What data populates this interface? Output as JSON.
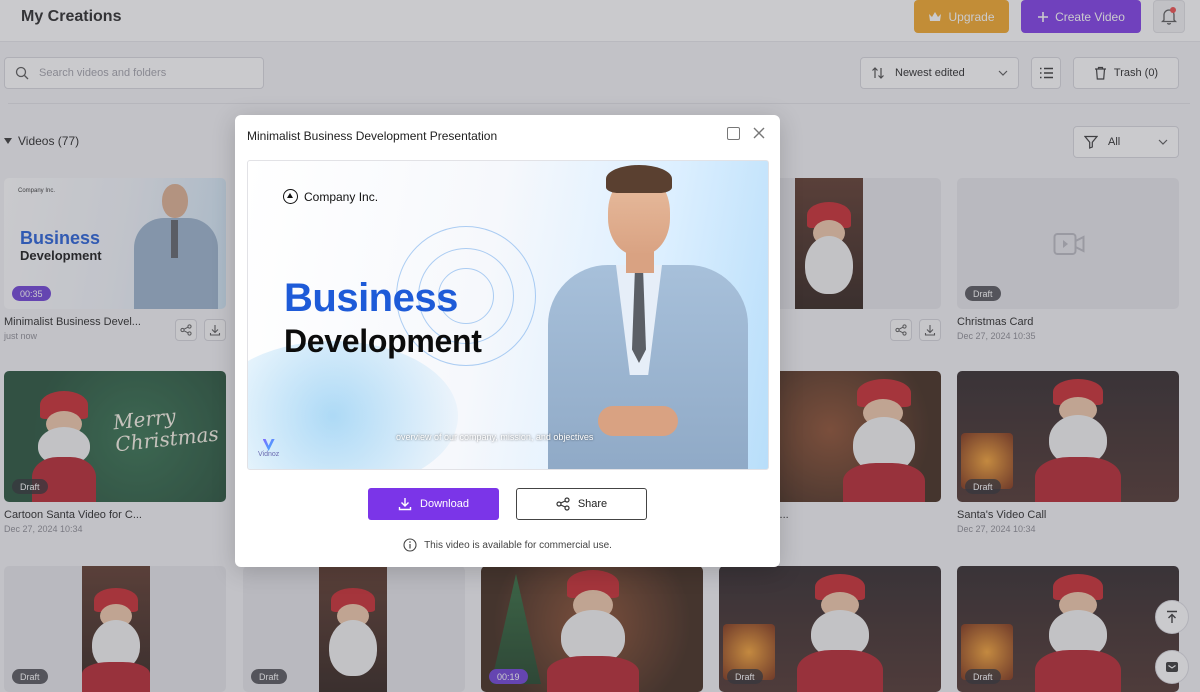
{
  "header": {
    "title": "My Creations",
    "upgrade_label": "Upgrade",
    "create_label": "Create Video"
  },
  "toolbar": {
    "search_placeholder": "Search videos and folders",
    "sort_value": "Newest edited",
    "trash_label": "Trash (0)"
  },
  "section": {
    "title": "Videos (77)",
    "filter_value": "All"
  },
  "cards": [
    {
      "title": "Minimalist Business Devel...",
      "date": "just now",
      "badge": "00:35"
    },
    {
      "title": "",
      "date": "",
      "badge": ""
    },
    {
      "title": "",
      "date": "",
      "badge": ""
    },
    {
      "title": "",
      "date": "35",
      "badge": ""
    },
    {
      "title": "Christmas Card",
      "date": "Dec 27, 2024 10:35",
      "badge": "Draft"
    },
    {
      "title": "Cartoon Santa Video for C...",
      "date": "Dec 27, 2024 10:34",
      "badge": "Draft"
    },
    {
      "title": "Message fro...",
      "date": "34",
      "badge": ""
    },
    {
      "title": "Santa's Video Call",
      "date": "Dec 27, 2024 10:34",
      "badge": "Draft"
    },
    {
      "title": "",
      "date": "",
      "badge": "Draft"
    },
    {
      "title": "",
      "date": "",
      "badge": "Draft"
    },
    {
      "title": "",
      "date": "",
      "badge": "00:19"
    },
    {
      "title": "",
      "date": "",
      "badge": "Draft"
    },
    {
      "title": "",
      "date": "",
      "badge": "Draft"
    }
  ],
  "thumb_text": {
    "company": "Company Inc.",
    "business": "Business",
    "development": "Development",
    "merry": "Merry",
    "christmas": "Christmas"
  },
  "modal": {
    "title": "Minimalist Business Development Presentation",
    "company": "Company Inc.",
    "headline1": "Business",
    "headline2": "Development",
    "caption": "overview of our company, mission, and objectives",
    "brand": "Vidnoz",
    "download_label": "Download",
    "share_label": "Share",
    "commercial_note": "This video is available for commercial use."
  },
  "colors": {
    "accent": "#7b35e8",
    "upgrade": "#f3a623",
    "headline_blue": "#1e5bd8"
  }
}
